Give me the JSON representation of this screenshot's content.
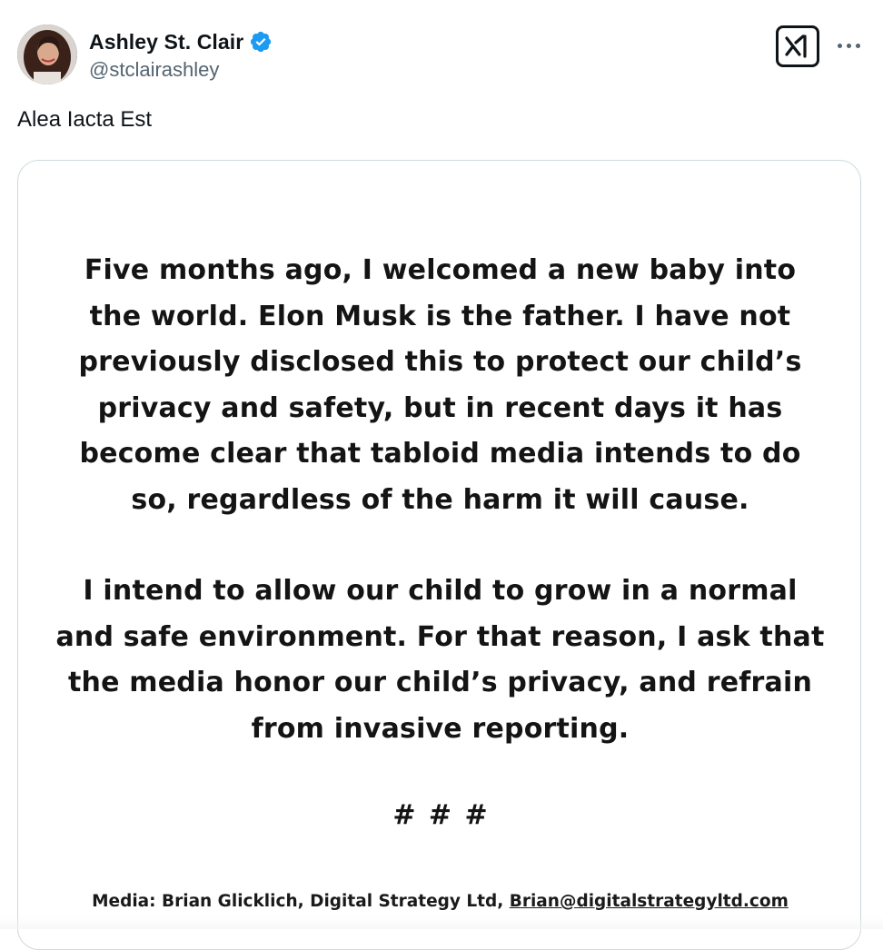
{
  "author": {
    "display_name": "Ashley St. Clair",
    "handle": "@stclairashley",
    "verified_color": "#1d9bf0"
  },
  "tweet": {
    "text": "Alea Iacta Est"
  },
  "statement": {
    "paragraph_1_lines": [
      "Five months ago, I welcomed a new baby into",
      "the world. Elon Musk is the father. I have not",
      "previously disclosed this to protect our child’s",
      "privacy and safety, but in recent days it has",
      "become clear that tabloid media intends to do",
      "so, regardless of the harm it will cause."
    ],
    "paragraph_2_lines": [
      "I intend to allow our child to grow in a normal",
      "and safe environment. For that reason, I ask that",
      "the media honor our child’s privacy, and refrain",
      "from invasive reporting."
    ],
    "separator": "# # #",
    "contact_prefix": "Media: Brian Glicklich, Digital Strategy Ltd, ",
    "contact_email": "Brian@digitalstrategyltd.com"
  },
  "icons": {
    "grok": "grok-icon",
    "more": "more-options-icon",
    "verified": "verified-badge-icon"
  }
}
